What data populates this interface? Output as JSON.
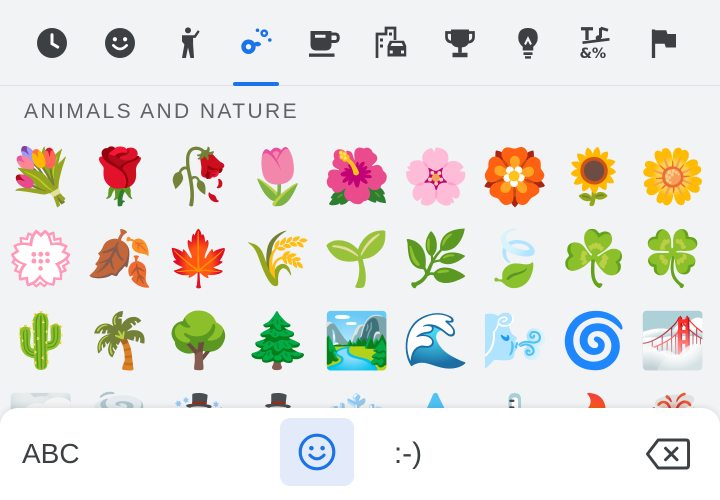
{
  "categories": [
    {
      "name": "recent",
      "icon": "clock-icon",
      "active": false
    },
    {
      "name": "smileys",
      "icon": "smiley-icon",
      "active": false
    },
    {
      "name": "people",
      "icon": "person-icon",
      "active": false
    },
    {
      "name": "animals-nature",
      "icon": "flower-icon",
      "active": true
    },
    {
      "name": "food-drink",
      "icon": "coffee-cup-icon",
      "active": false
    },
    {
      "name": "travel-places",
      "icon": "car-building-icon",
      "active": false
    },
    {
      "name": "activities",
      "icon": "trophy-icon",
      "active": false
    },
    {
      "name": "objects",
      "icon": "lightbulb-icon",
      "active": false
    },
    {
      "name": "symbols",
      "icon": "symbols-icon",
      "active": false
    },
    {
      "name": "flags",
      "icon": "flag-icon",
      "active": false
    }
  ],
  "section_title": "ANIMALS AND NATURE",
  "emojis": [
    "💐",
    "🌹",
    "🥀",
    "🌷",
    "🌺",
    "🌸",
    "🏵️",
    "🌻",
    "🌼",
    "💮",
    "🍂",
    "🍁",
    "🌾",
    "🌱",
    "🌿",
    "🍃",
    "☘️",
    "🍀",
    "🌵",
    "🌴",
    "🌳",
    "🌲",
    "🏞️",
    "🌊",
    "🌬️",
    "🌀",
    "🌁",
    "🌫️",
    "🌪️",
    "☃️",
    "⛄",
    "❄️",
    "💧",
    "🌡️",
    "🔥",
    "🌋"
  ],
  "bottom_bar": {
    "abc_label": "ABC",
    "emoticon_label": ":-)",
    "emoji_icon": "smiley-icon",
    "delete_icon": "backspace-icon"
  },
  "colors": {
    "accent": "#1a73e8",
    "icon_gray": "#3c4043",
    "title_gray": "#5f6368",
    "emoji_tab_bg": "#e3ebfa"
  }
}
